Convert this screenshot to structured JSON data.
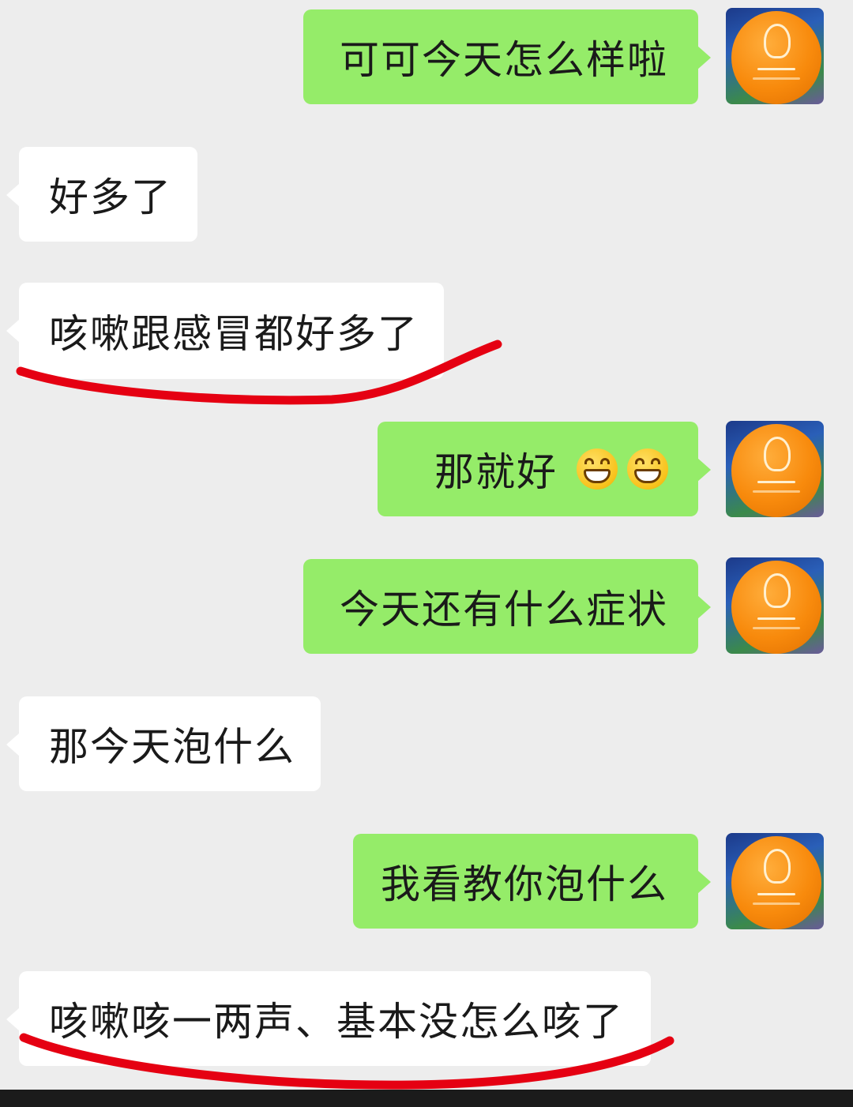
{
  "messages": [
    {
      "side": "sent",
      "text": "可可今天怎么样啦"
    },
    {
      "side": "received",
      "text": "好多了"
    },
    {
      "side": "received",
      "text": "咳嗽跟感冒都好多了"
    },
    {
      "side": "sent",
      "text": "那就好",
      "emoji": [
        "grinning-face-icon",
        "grinning-face-icon"
      ]
    },
    {
      "side": "sent",
      "text": "今天还有什么症状"
    },
    {
      "side": "received",
      "text": "那今天泡什么"
    },
    {
      "side": "sent",
      "text": "我看教你泡什么"
    },
    {
      "side": "received",
      "text": "咳嗽咳一两声、基本没怎么咳了"
    }
  ],
  "colors": {
    "background": "#ededed",
    "sent_bubble": "#95ec69",
    "received_bubble": "#ffffff",
    "avatar_balloon": "#f88a0c",
    "annotation_underline": "#e50012"
  },
  "annotations": [
    {
      "type": "red-underline",
      "target_message": 2
    },
    {
      "type": "red-underline",
      "target_message": 7
    }
  ]
}
